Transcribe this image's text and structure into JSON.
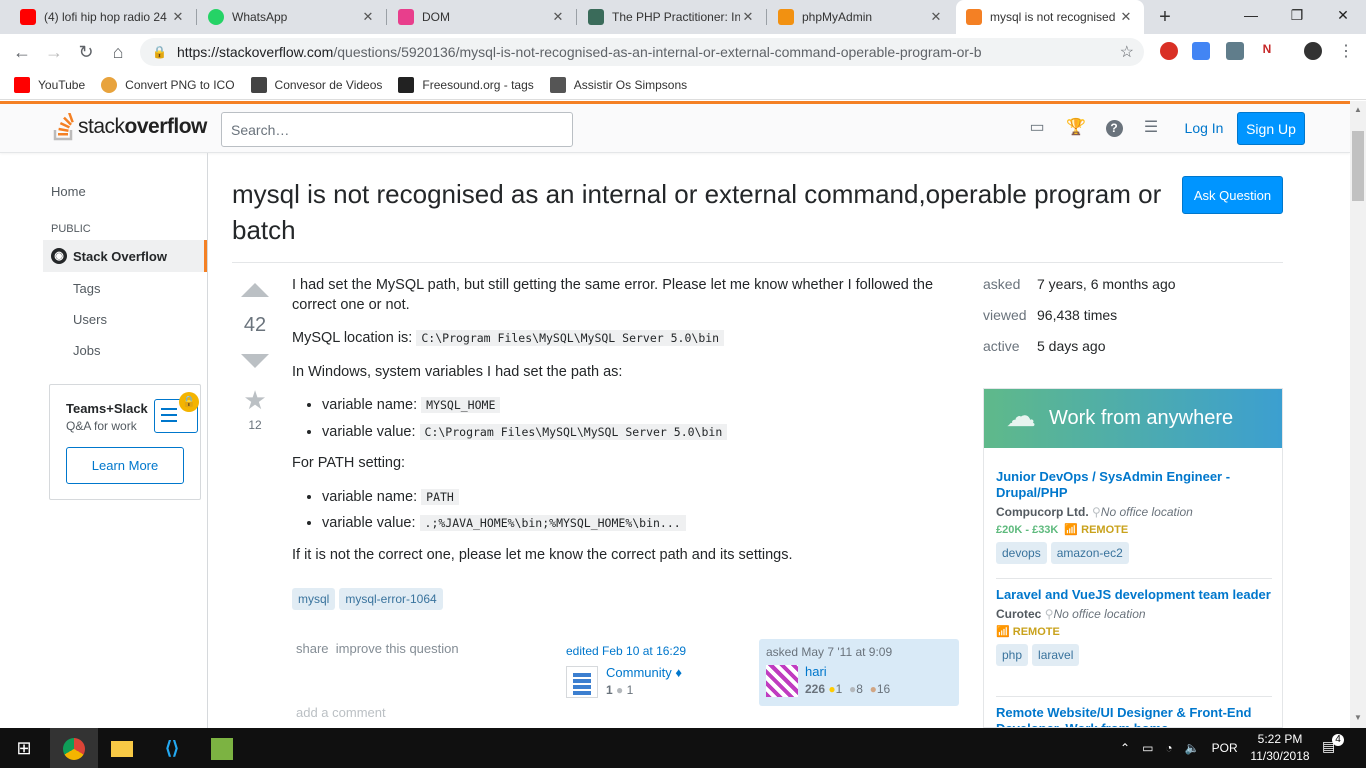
{
  "browser": {
    "tabs": [
      {
        "title": "(4) lofi hip hop radio 24",
        "color": "#ff0000"
      },
      {
        "title": "WhatsApp",
        "color": "#25d366"
      },
      {
        "title": "DOM",
        "color": "#e83e8c"
      },
      {
        "title": "The PHP Practitioner: In",
        "color": "#3a6b5a"
      },
      {
        "title": "phpMyAdmin",
        "color": "#f29111"
      },
      {
        "title": "mysql is not recognised",
        "color": "#f48024"
      }
    ],
    "url_host": "https://stackoverflow.com",
    "url_path": "/questions/5920136/mysql-is-not-recognised-as-an-internal-or-external-command-operable-program-or-b",
    "bookmarks": [
      {
        "label": "YouTube",
        "color": "#ff0000"
      },
      {
        "label": "Convert PNG to ICO",
        "color": "#e8a33d"
      },
      {
        "label": "Convesor de Videos",
        "color": "#444444"
      },
      {
        "label": "Freesound.org - tags",
        "color": "#222222"
      },
      {
        "label": "Assistir Os Simpsons",
        "color": "#555555"
      }
    ]
  },
  "so": {
    "logo_plain": "stack",
    "logo_bold": "overflow",
    "search_placeholder": "Search…",
    "login": "Log In",
    "signup": "Sign Up"
  },
  "nav": {
    "home": "Home",
    "public": "PUBLIC",
    "active": "Stack Overflow",
    "tags": "Tags",
    "users": "Users",
    "jobs": "Jobs",
    "teams_title": "Teams+Slack",
    "teams_sub": "Q&A for work",
    "learn_more": "Learn More"
  },
  "question": {
    "title": "mysql is not recognised as an internal or external command,operable program or batch",
    "ask_button": "Ask Question",
    "votes": "42",
    "favorites": "12",
    "p1": "I had set the MySQL path, but still getting the same error. Please let me know whether I followed the correct one or not.",
    "p2": "MySQL location is:",
    "p2_code": "C:\\Program Files\\MySQL\\MySQL Server 5.0\\bin",
    "p3": "In Windows, system variables I had set the path as:",
    "li1": "variable name:",
    "li1_code": "MYSQL_HOME",
    "li2": "variable value:",
    "li2_code": "C:\\Program Files\\MySQL\\MySQL Server 5.0\\bin",
    "p4": "For PATH setting:",
    "li3": "variable name:",
    "li3_code": "PATH",
    "li4": "variable value:",
    "li4_code": ".;%JAVA_HOME%\\bin;%MYSQL_HOME%\\bin...",
    "p5": "If it is not the correct one, please let me know the correct path and its settings.",
    "tags": [
      "mysql",
      "mysql-error-1064"
    ],
    "share": "share",
    "improve": "improve this question",
    "edited": "edited Feb 10 at 16:29",
    "editor": "Community ♦",
    "editor_rep": "1",
    "editor_badge": "1",
    "asked_label": "asked May 7 '11 at 9:09",
    "asker": "hari",
    "asker_rep": "226",
    "gold": "1",
    "silver": "8",
    "bronze": "16",
    "add_comment": "add a comment"
  },
  "meta": {
    "asked_k": "asked",
    "asked_v": "7 years, 6 months ago",
    "viewed_k": "viewed",
    "viewed_v": "96,438 times",
    "active_k": "active",
    "active_v": "5 days ago"
  },
  "jobs": {
    "header": "Work from anywhere",
    "items": [
      {
        "title": "Junior DevOps / SysAdmin Engineer - Drupal/PHP",
        "company": "Compucorp Ltd.",
        "location": "No office location",
        "salary": "£20K - £33K",
        "remote": "REMOTE",
        "tags": [
          "devops",
          "amazon-ec2"
        ]
      },
      {
        "title": "Laravel and VueJS development team leader",
        "company": "Curotec",
        "location": "No office location",
        "salary": "",
        "remote": "REMOTE",
        "tags": [
          "php",
          "laravel"
        ]
      },
      {
        "title": "Remote Website/UI Designer & Front-End Developer, Work from home"
      }
    ]
  },
  "taskbar": {
    "lang": "POR",
    "time": "5:22 PM",
    "date": "11/30/2018",
    "notif": "4"
  }
}
